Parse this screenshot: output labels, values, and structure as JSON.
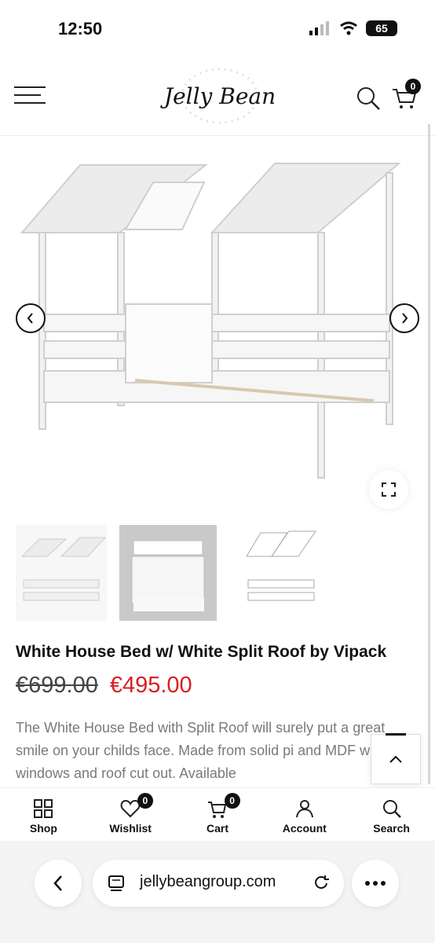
{
  "status": {
    "time": "12:50",
    "battery": "65"
  },
  "header": {
    "logo_title": "Jelly Bean",
    "logo_subtitle": "",
    "cart_count": "0"
  },
  "gallery": {
    "thumbnails": [
      "bed-white",
      "bed-room",
      "bed-drawing"
    ]
  },
  "product": {
    "title": "White House Bed w/ White Split Roof by Vipack",
    "old_price": "€699.00",
    "new_price": "€495.00",
    "description": "The White House Bed with Split Roof will surely put a great smile on your childs face. Made from solid pi and MDF with windows and roof cut out. Available"
  },
  "bottom_nav": [
    {
      "label": "Shop",
      "icon": "grid-icon"
    },
    {
      "label": "Wishlist",
      "icon": "heart-icon",
      "badge": "0"
    },
    {
      "label": "Cart",
      "icon": "cart-icon",
      "badge": "0"
    },
    {
      "label": "Account",
      "icon": "user-icon"
    },
    {
      "label": "Search",
      "icon": "search-icon"
    }
  ],
  "browser": {
    "url": "jellybeangroup.com"
  }
}
